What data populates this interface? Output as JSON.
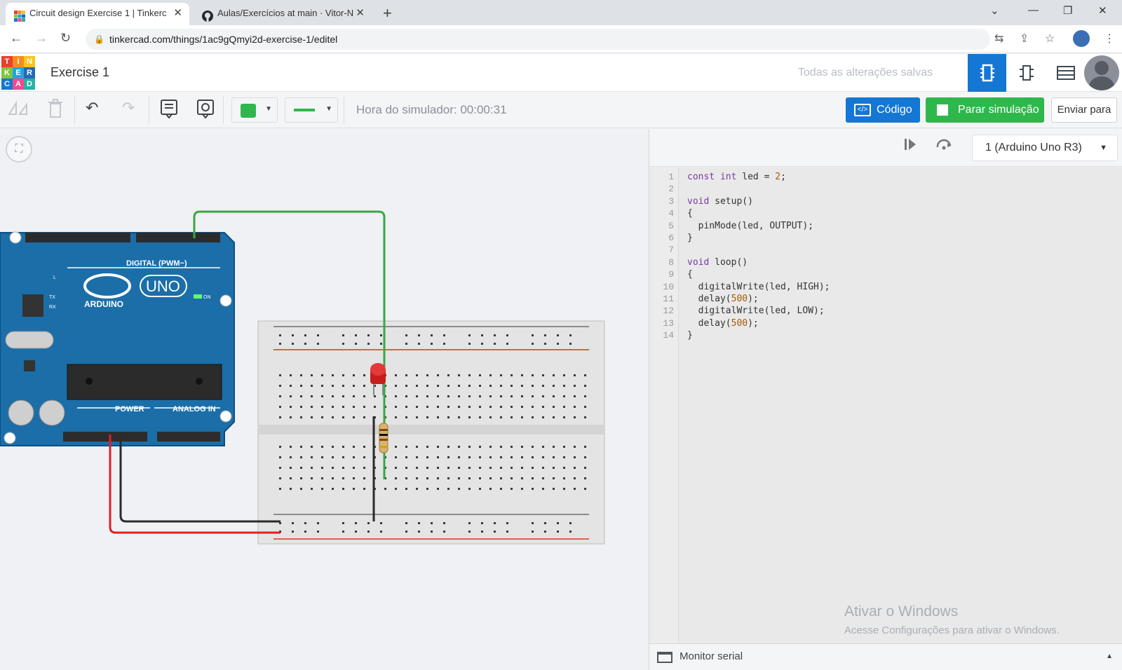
{
  "browser": {
    "tabs": [
      {
        "title": "Circuit design Exercise 1 | Tinkerc",
        "active": true
      },
      {
        "title": "Aulas/Exercícios at main · Vitor-N",
        "active": false
      }
    ],
    "new_tab": "+",
    "url": "tinkercad.com/things/1ac9gQmyi2d-exercise-1/editel"
  },
  "app": {
    "logo_letters": [
      "T",
      "I",
      "N",
      "K",
      "E",
      "R",
      "C",
      "A",
      "D"
    ],
    "logo_colors": [
      "#e8412f",
      "#f58d1e",
      "#fcc41c",
      "#7ec73f",
      "#1aa9e0",
      "#2468b8",
      "#1477d4",
      "#ee4c8f",
      "#27b2a5"
    ],
    "project_title": "Exercise 1",
    "save_status": "Todas as alterações salvas"
  },
  "toolbar": {
    "simulator_time": "Hora do simulador: 00:00:31",
    "code_label": "Código",
    "stop_sim_label": "Parar simulação",
    "send_label": "Enviar para",
    "fill_color": "#2eb84b",
    "wire_color": "#2eb84b"
  },
  "code_panel": {
    "board": "1 (Arduino Uno R3)",
    "code_lines": [
      {
        "n": "1",
        "text": "const int led = 2;"
      },
      {
        "n": "2",
        "text": ""
      },
      {
        "n": "3",
        "text": "void setup()"
      },
      {
        "n": "4",
        "text": "{"
      },
      {
        "n": "5",
        "text": "  pinMode(led, OUTPUT);"
      },
      {
        "n": "6",
        "text": "}"
      },
      {
        "n": "7",
        "text": ""
      },
      {
        "n": "8",
        "text": "void loop()"
      },
      {
        "n": "9",
        "text": "{"
      },
      {
        "n": "10",
        "text": "  digitalWrite(led, HIGH);"
      },
      {
        "n": "11",
        "text": "  delay(500);"
      },
      {
        "n": "12",
        "text": "  digitalWrite(led, LOW);"
      },
      {
        "n": "13",
        "text": "  delay(500);"
      },
      {
        "n": "14",
        "text": "}"
      }
    ],
    "serial_monitor": "Monitor serial"
  },
  "watermark": {
    "line1": "Ativar o Windows",
    "line2": "Acesse Configurações para ativar o Windows."
  },
  "arduino": {
    "brand": "ARDUINO",
    "model": "UNO",
    "digital_label": "DIGITAL (PWM~)",
    "power_label": "POWER",
    "analog_label": "ANALOG IN",
    "on_label": "ON",
    "l_label": "L",
    "tx_label": "TX",
    "rx_label": "RX"
  }
}
